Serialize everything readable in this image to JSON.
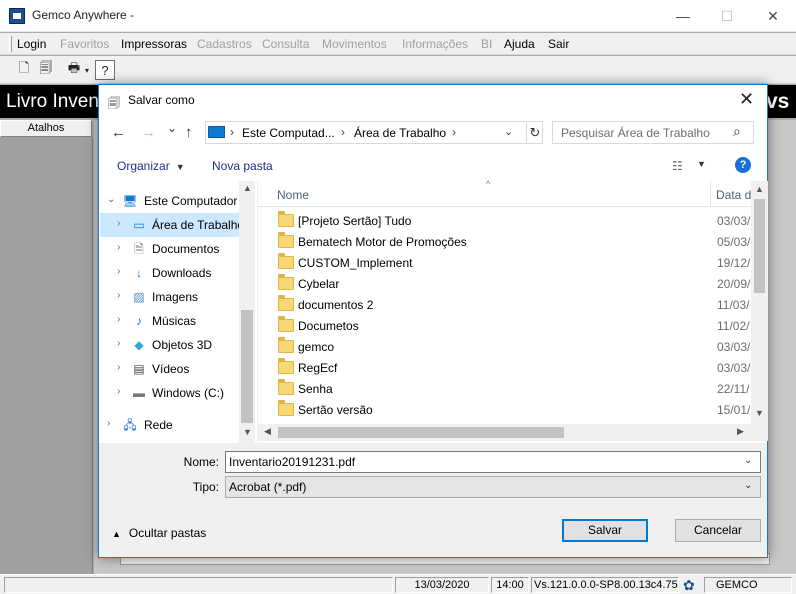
{
  "app": {
    "title": "Gemco Anywhere -",
    "window_controls": {
      "minimize": "—",
      "maximize": "☐",
      "close": "✕"
    },
    "menu": [
      {
        "label": "Login",
        "enabled": true
      },
      {
        "label": "Favoritos",
        "enabled": false
      },
      {
        "label": "Impressoras",
        "enabled": true
      },
      {
        "label": "Cadastros",
        "enabled": false
      },
      {
        "label": "Consulta",
        "enabled": false
      },
      {
        "label": "Movimentos",
        "enabled": false
      },
      {
        "label": "Informações",
        "enabled": false
      },
      {
        "label": "BI",
        "enabled": false
      },
      {
        "label": "Ajuda",
        "enabled": true
      },
      {
        "label": "Sair",
        "enabled": true
      }
    ],
    "banner_text": "Livro Invent",
    "banner_right": "vs",
    "side_tab": "Atalhos",
    "status": {
      "date": "13/03/2020",
      "time": "14:00",
      "version": "Vs.121.0.0.0-SP8.00.13c4.75",
      "company": "GEMCO"
    }
  },
  "dialog": {
    "title": "Salvar como",
    "close_glyph": "✕",
    "nav": {
      "back": "←",
      "forward": "→",
      "recent": "⌄",
      "up": "↑"
    },
    "address": {
      "segments": [
        "Este Computad...",
        "Área de Trabalho"
      ],
      "separator": "›",
      "dropdown": "⌄",
      "refresh": "↻"
    },
    "search_placeholder": "Pesquisar Área de Trabalho",
    "commands": {
      "organize": "Organizar",
      "new_folder": "Nova pasta"
    },
    "help": "?",
    "nav_pane": [
      {
        "label": "Este Computador",
        "icon": "computer-icon",
        "expanded": true,
        "level": 0,
        "selected": false
      },
      {
        "label": "Área de Trabalho",
        "icon": "desktop-icon",
        "expanded": false,
        "level": 1,
        "selected": true
      },
      {
        "label": "Documentos",
        "icon": "documents-icon",
        "expanded": false,
        "level": 1,
        "selected": false
      },
      {
        "label": "Downloads",
        "icon": "downloads-icon",
        "expanded": false,
        "level": 1,
        "selected": false
      },
      {
        "label": "Imagens",
        "icon": "pictures-icon",
        "expanded": false,
        "level": 1,
        "selected": false
      },
      {
        "label": "Músicas",
        "icon": "music-icon",
        "expanded": false,
        "level": 1,
        "selected": false
      },
      {
        "label": "Objetos 3D",
        "icon": "objects-3d-icon",
        "expanded": false,
        "level": 1,
        "selected": false
      },
      {
        "label": "Vídeos",
        "icon": "videos-icon",
        "expanded": false,
        "level": 1,
        "selected": false
      },
      {
        "label": "Windows (C:)",
        "icon": "drive-icon",
        "expanded": false,
        "level": 1,
        "selected": false
      },
      {
        "label": "Rede",
        "icon": "network-icon",
        "expanded": false,
        "level": 0,
        "selected": false
      }
    ],
    "columns": {
      "name": "Nome",
      "date": "Data d"
    },
    "files": [
      {
        "name": "[Projeto Sertão] Tudo",
        "date": "03/03/"
      },
      {
        "name": "Bematech Motor de Promoções",
        "date": "05/03/"
      },
      {
        "name": "CUSTOM_Implement",
        "date": "19/12/"
      },
      {
        "name": "Cybelar",
        "date": "20/09/"
      },
      {
        "name": "documentos 2",
        "date": "11/03/"
      },
      {
        "name": "Documetos",
        "date": "11/02/"
      },
      {
        "name": "gemco",
        "date": "03/03/"
      },
      {
        "name": "RegEcf",
        "date": "03/03/"
      },
      {
        "name": "Senha",
        "date": "22/11/"
      },
      {
        "name": "Sertão versão",
        "date": "15/01/"
      }
    ],
    "filename_label": "Nome:",
    "filename_value": "Inventario20191231.pdf",
    "type_label": "Tipo:",
    "type_value": "Acrobat (*.pdf)",
    "hide_folders": "Ocultar pastas",
    "save_button": "Salvar",
    "cancel_button": "Cancelar"
  },
  "colors": {
    "accent": "#0078d7",
    "selection": "#cce8ff",
    "folder": "#f8d775",
    "command_text": "#1e3287"
  }
}
